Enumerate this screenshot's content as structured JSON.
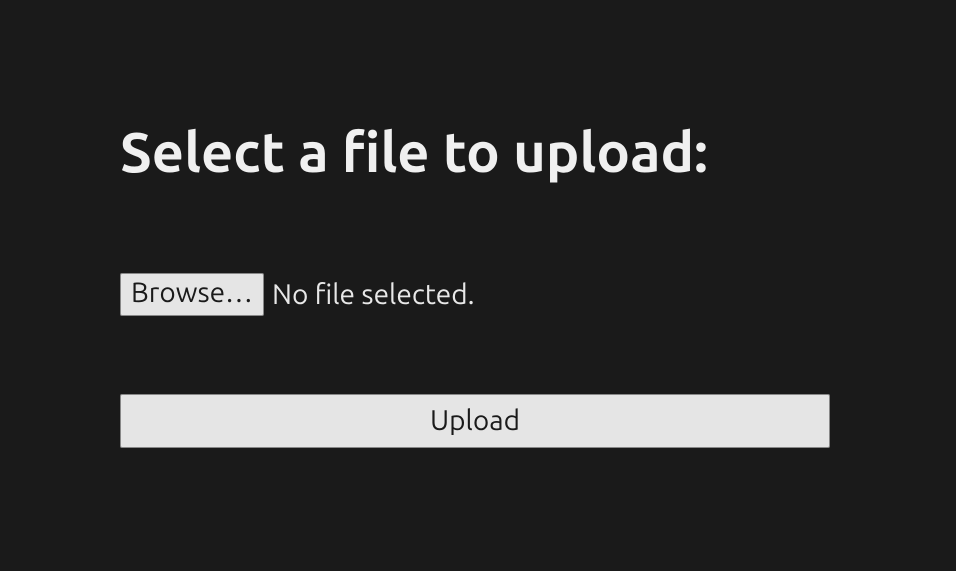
{
  "heading": "Select a file to upload:",
  "fileInput": {
    "browseLabel": "Browse…",
    "status": "No file selected."
  },
  "uploadLabel": "Upload"
}
